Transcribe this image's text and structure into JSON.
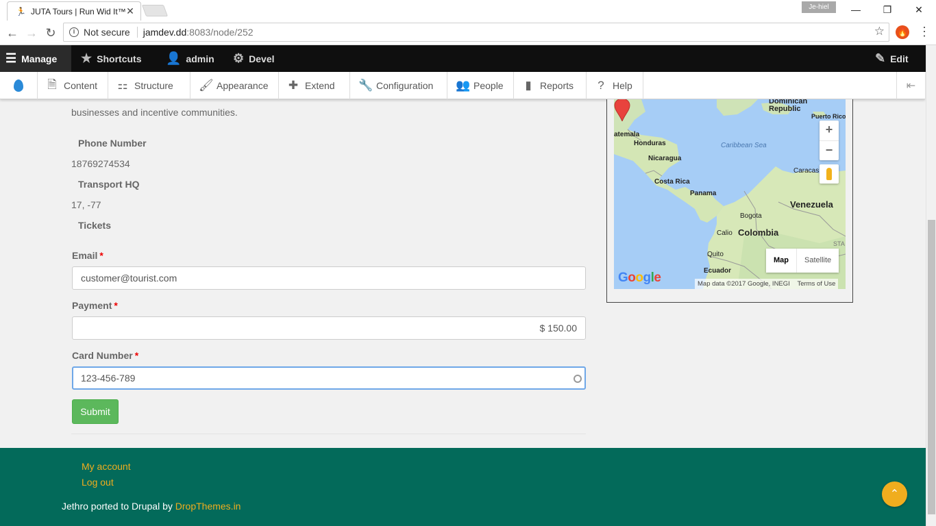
{
  "browser": {
    "tab_title": "JUTA Tours | Run Wid It™",
    "tab_close": "✕",
    "profile_name": "Je-hiel",
    "security_label": "Not secure",
    "url_host": "jamdev.dd",
    "url_rest": ":8083/node/252",
    "min": "—",
    "restore": "❐",
    "close": "✕"
  },
  "toolbar": {
    "manage": "Manage",
    "shortcuts": "Shortcuts",
    "user": "admin",
    "devel": "Devel",
    "edit": "Edit"
  },
  "tray": {
    "items": [
      "Content",
      "Structure",
      "Appearance",
      "Extend",
      "Configuration",
      "People",
      "Reports",
      "Help"
    ]
  },
  "content": {
    "intro": "businesses and incentive communities.",
    "phone_label": "Phone Number",
    "phone_value": "18769274534",
    "hq_label": "Transport HQ",
    "hq_value": "17, -77",
    "tickets_label": "Tickets"
  },
  "form": {
    "email_label": "Email",
    "email_value": "customer@tourist.com",
    "payment_label": "Payment",
    "payment_value": "$ 150.00",
    "card_label": "Card Number",
    "card_value": "123-456-789",
    "required_mark": "*",
    "submit": "Submit"
  },
  "map": {
    "labels": {
      "dominican": "Dominican",
      "republic": "Republic",
      "puerto_rico": "Puerto Rico",
      "guatemala": "atemala",
      "honduras": "Honduras",
      "caribbean": "Caribbean Sea",
      "nicaragua": "Nicaragua",
      "costa_rica": "Costa Rica",
      "panama": "Panama",
      "caracas": "Caracas",
      "venezuela": "Venezuela",
      "bogota": "Bogota",
      "cali": "Calio",
      "colombia": "Colombia",
      "quito": "Quito",
      "ecuador": "Ecuador",
      "sta": "STA"
    },
    "zoom_in": "+",
    "zoom_out": "−",
    "map_type": "Map",
    "satellite": "Satellite",
    "attribution": "Map data ©2017 Google, INEGI",
    "terms": "Terms of Use"
  },
  "footer": {
    "my_account": "My account",
    "log_out": "Log out",
    "credit_text": "Jethro ported to Drupal by ",
    "credit_link": "DropThemes.in"
  },
  "colors": {
    "footer_bg": "#036a5a",
    "accent": "#f0ad1e",
    "submit_bg": "#5cb85c",
    "toolbar_bg": "#0f0f0f"
  }
}
